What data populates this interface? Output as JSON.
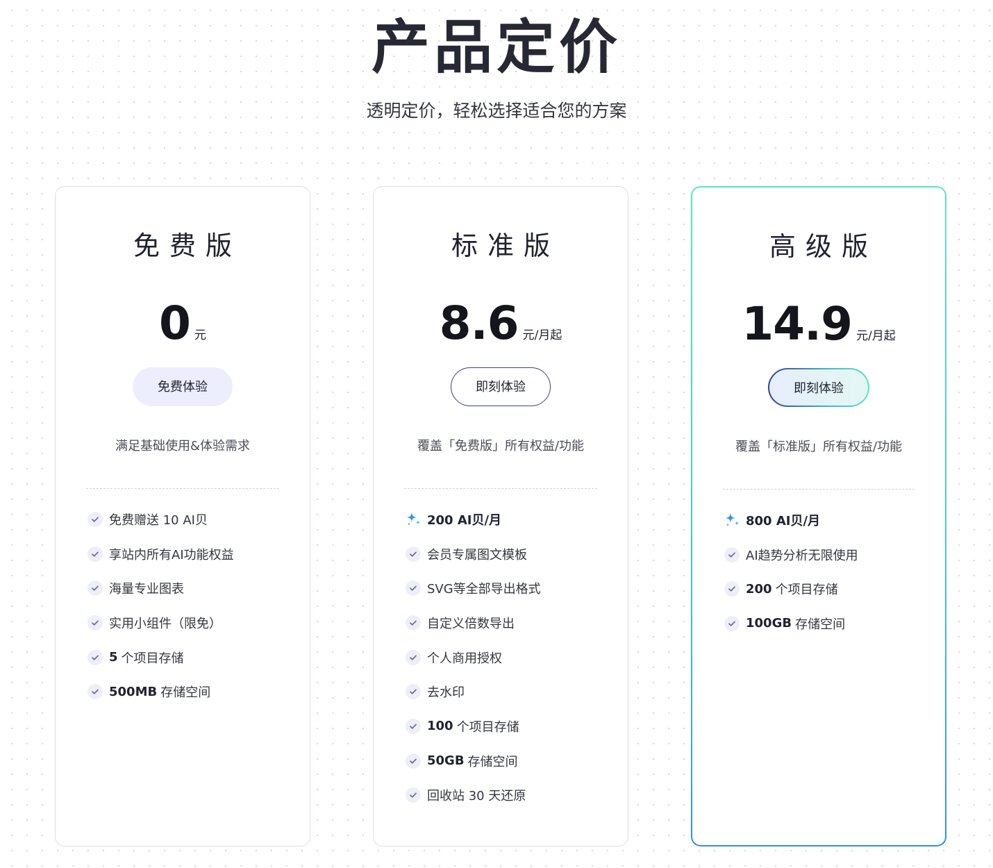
{
  "header": {
    "title": "产品定价",
    "subtitle": "透明定价，轻松选择适合您的方案"
  },
  "plans": [
    {
      "name": "免费版",
      "price": "0",
      "unit": "元",
      "cta": "免费体验",
      "desc": "满足基础使用&体验需求",
      "features": [
        {
          "text": "免费赠送 10 AI贝"
        },
        {
          "text": "享站内所有AI功能权益"
        },
        {
          "text": "海量专业图表"
        },
        {
          "text": "实用小组件（限免）"
        },
        {
          "num": "5",
          "text": "个项目存储"
        },
        {
          "num": "500MB",
          "text": "存储空间"
        }
      ]
    },
    {
      "name": "标准版",
      "price": "8.6",
      "unit": "元/月起",
      "cta": "即刻体验",
      "desc": "覆盖「免费版」所有权益/功能",
      "highlight": "200 AI贝/月",
      "features": [
        {
          "text": "会员专属图文模板"
        },
        {
          "text": "SVG等全部导出格式"
        },
        {
          "text": "自定义倍数导出"
        },
        {
          "text": "个人商用授权"
        },
        {
          "text": "去水印"
        },
        {
          "num": "100",
          "text": "个项目存储"
        },
        {
          "num": "50GB",
          "text": "存储空间"
        },
        {
          "text": "回收站 30 天还原"
        }
      ]
    },
    {
      "name": "高级版",
      "price": "14.9",
      "unit": "元/月起",
      "cta": "即刻体验",
      "desc": "覆盖「标准版」所有权益/功能",
      "highlight": "800 AI贝/月",
      "features": [
        {
          "text": "AI趋势分析无限使用"
        },
        {
          "num": "200",
          "text": "个项目存储"
        },
        {
          "num": "100GB",
          "text": "存储空间"
        }
      ]
    }
  ],
  "colors": {
    "accent_blue": "#2f6bf0",
    "accent_teal": "#59e6bd",
    "check": "#6a6fa8",
    "cta_free_bg": "#eceefe"
  },
  "icons": {
    "check": "check-icon",
    "spark": "sparkle-icon"
  }
}
